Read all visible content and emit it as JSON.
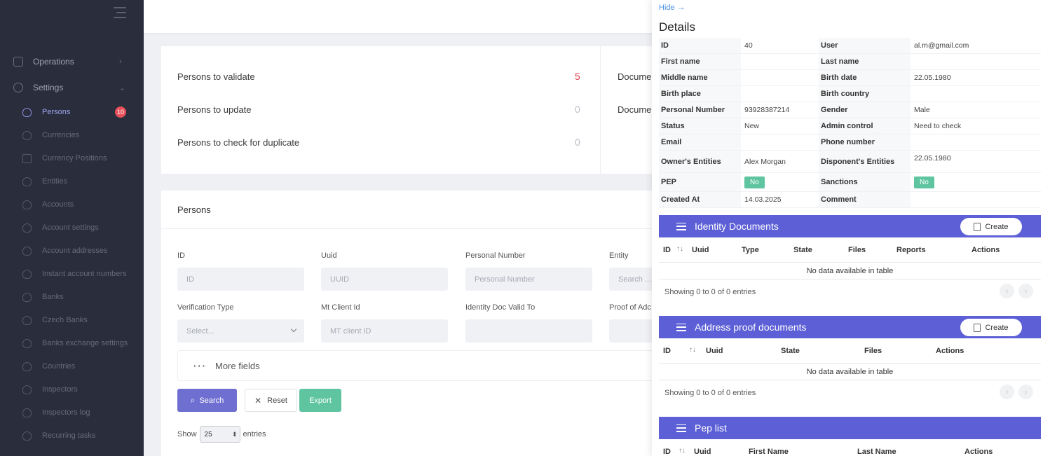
{
  "sidebar": {
    "top": [
      {
        "label": "Operations",
        "icon": "layers-icon"
      },
      {
        "label": "Settings",
        "icon": "gear-icon"
      }
    ],
    "items": [
      {
        "label": "Persons",
        "badge": "10"
      },
      {
        "label": "Currencies"
      },
      {
        "label": "Currency Positions"
      },
      {
        "label": "Entities"
      },
      {
        "label": "Accounts"
      },
      {
        "label": "Account settings"
      },
      {
        "label": "Account addresses"
      },
      {
        "label": "Instant account numbers"
      },
      {
        "label": "Banks"
      },
      {
        "label": "Czech Banks"
      },
      {
        "label": "Banks exchange settings"
      },
      {
        "label": "Countries"
      },
      {
        "label": "Inspectors"
      },
      {
        "label": "Inspectors log"
      },
      {
        "label": "Recurring tasks"
      }
    ]
  },
  "stats": [
    {
      "label": "Persons to validate",
      "value": "5"
    },
    {
      "label": "Persons to update",
      "value": "0"
    },
    {
      "label": "Persons to check for duplicate",
      "value": "0"
    }
  ],
  "docs": [
    "Docume",
    "Docume"
  ],
  "persons": {
    "title": "Persons",
    "filters": {
      "id": {
        "label": "ID",
        "placeholder": "ID"
      },
      "uuid": {
        "label": "Uuid",
        "placeholder": "UUID"
      },
      "personal_number": {
        "label": "Personal Number",
        "placeholder": "Personal Number"
      },
      "entity": {
        "label": "Entity",
        "placeholder": "Search ..."
      },
      "verification_type": {
        "label": "Verification Type",
        "placeholder": "Select..."
      },
      "mt_client_id": {
        "label": "Mt Client Id",
        "placeholder": "MT client ID"
      },
      "identity_doc_valid_to": {
        "label": "Identity Doc Valid To",
        "placeholder": ""
      },
      "proof_of_address": {
        "label": "Proof of Adc",
        "placeholder": ""
      }
    },
    "more_fields": "More fields",
    "buttons": {
      "search": "Search",
      "reset": "Reset",
      "export": "Export"
    },
    "show": {
      "prefix": "Show",
      "value": "25",
      "suffix": "entries"
    }
  },
  "details": {
    "hide": "Hide",
    "title": "Details",
    "rows": [
      {
        "l1": "ID",
        "v1": "40",
        "l2": "User",
        "v2": "al.m@gmail.com"
      },
      {
        "l1": "First name",
        "v1": "",
        "l2": "Last name",
        "v2": ""
      },
      {
        "l1": "Middle name",
        "v1": "",
        "l2": "Birth date",
        "v2": "22.05.1980"
      },
      {
        "l1": "Birth place",
        "v1": "",
        "l2": "Birth country",
        "v2": ""
      },
      {
        "l1": "Personal Number",
        "v1": "93928387214",
        "l2": "Gender",
        "v2": "Male"
      },
      {
        "l1": "Status",
        "v1": "New",
        "l2": "Admin control",
        "v2": "Need to check"
      },
      {
        "l1": "Email",
        "v1": "",
        "l2": "Phone number",
        "v2": ""
      },
      {
        "l1": "Owner's Entities",
        "v1": "Alex Morgan",
        "l2": "Disponent's Entities",
        "v2": "22.05.1980"
      },
      {
        "l1": "PEP",
        "v1": "No",
        "l2": "Sanctions",
        "v2": "No"
      },
      {
        "l1": "Created At",
        "v1": "14.03.2025",
        "l2": "Comment",
        "v2": ""
      }
    ]
  },
  "identity_docs": {
    "title": "Identity Documents",
    "create": "Create",
    "columns": [
      "ID",
      "Uuid",
      "Type",
      "State",
      "Files",
      "Reports",
      "Actions"
    ],
    "empty": "No data available in table",
    "showing": "Showing 0 to 0 of 0 entries"
  },
  "address_docs": {
    "title": "Address proof documents",
    "create": "Create",
    "columns": [
      "ID",
      "Uuid",
      "State",
      "Files",
      "Actions"
    ],
    "empty": "No data available in table",
    "showing": "Showing 0 to 0 of 0 entries"
  },
  "pep_list": {
    "title": "Pep list",
    "columns": [
      "ID",
      "Uuid",
      "First Name",
      "Last Name",
      "Actions"
    ]
  },
  "colors": {
    "accent": "#5c5fd6",
    "success": "#5ec5a0",
    "danger": "#e2434d",
    "sidebar": "#2a2d3b"
  }
}
